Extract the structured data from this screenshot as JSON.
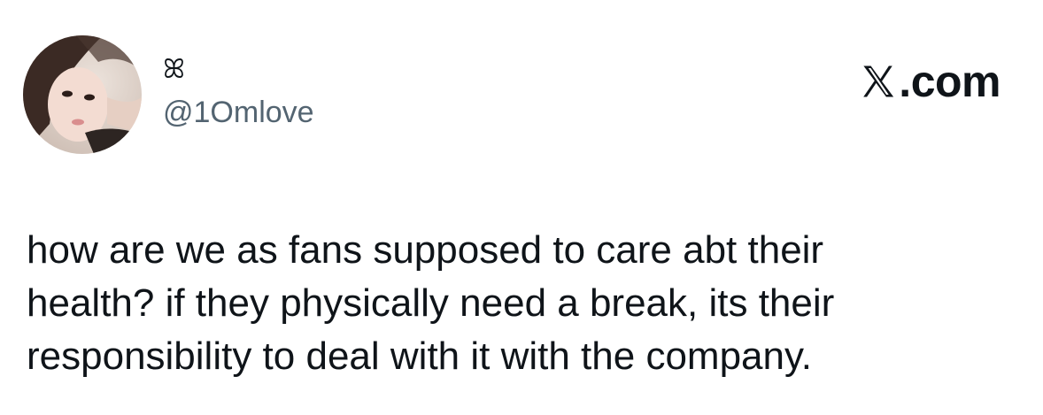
{
  "author": {
    "display_name": "ꕤ",
    "handle": "@1Omlove",
    "avatar": "profile-photo"
  },
  "brand": {
    "icon": "x-logo-icon",
    "label": ".com"
  },
  "tweet": {
    "text": "how are we as fans supposed to care abt their\nhealth? if they physically need a break, its their\nresponsibility to deal with it with the company."
  },
  "colors": {
    "text_primary": "#0f1419",
    "text_secondary": "#536471",
    "background": "#ffffff"
  }
}
